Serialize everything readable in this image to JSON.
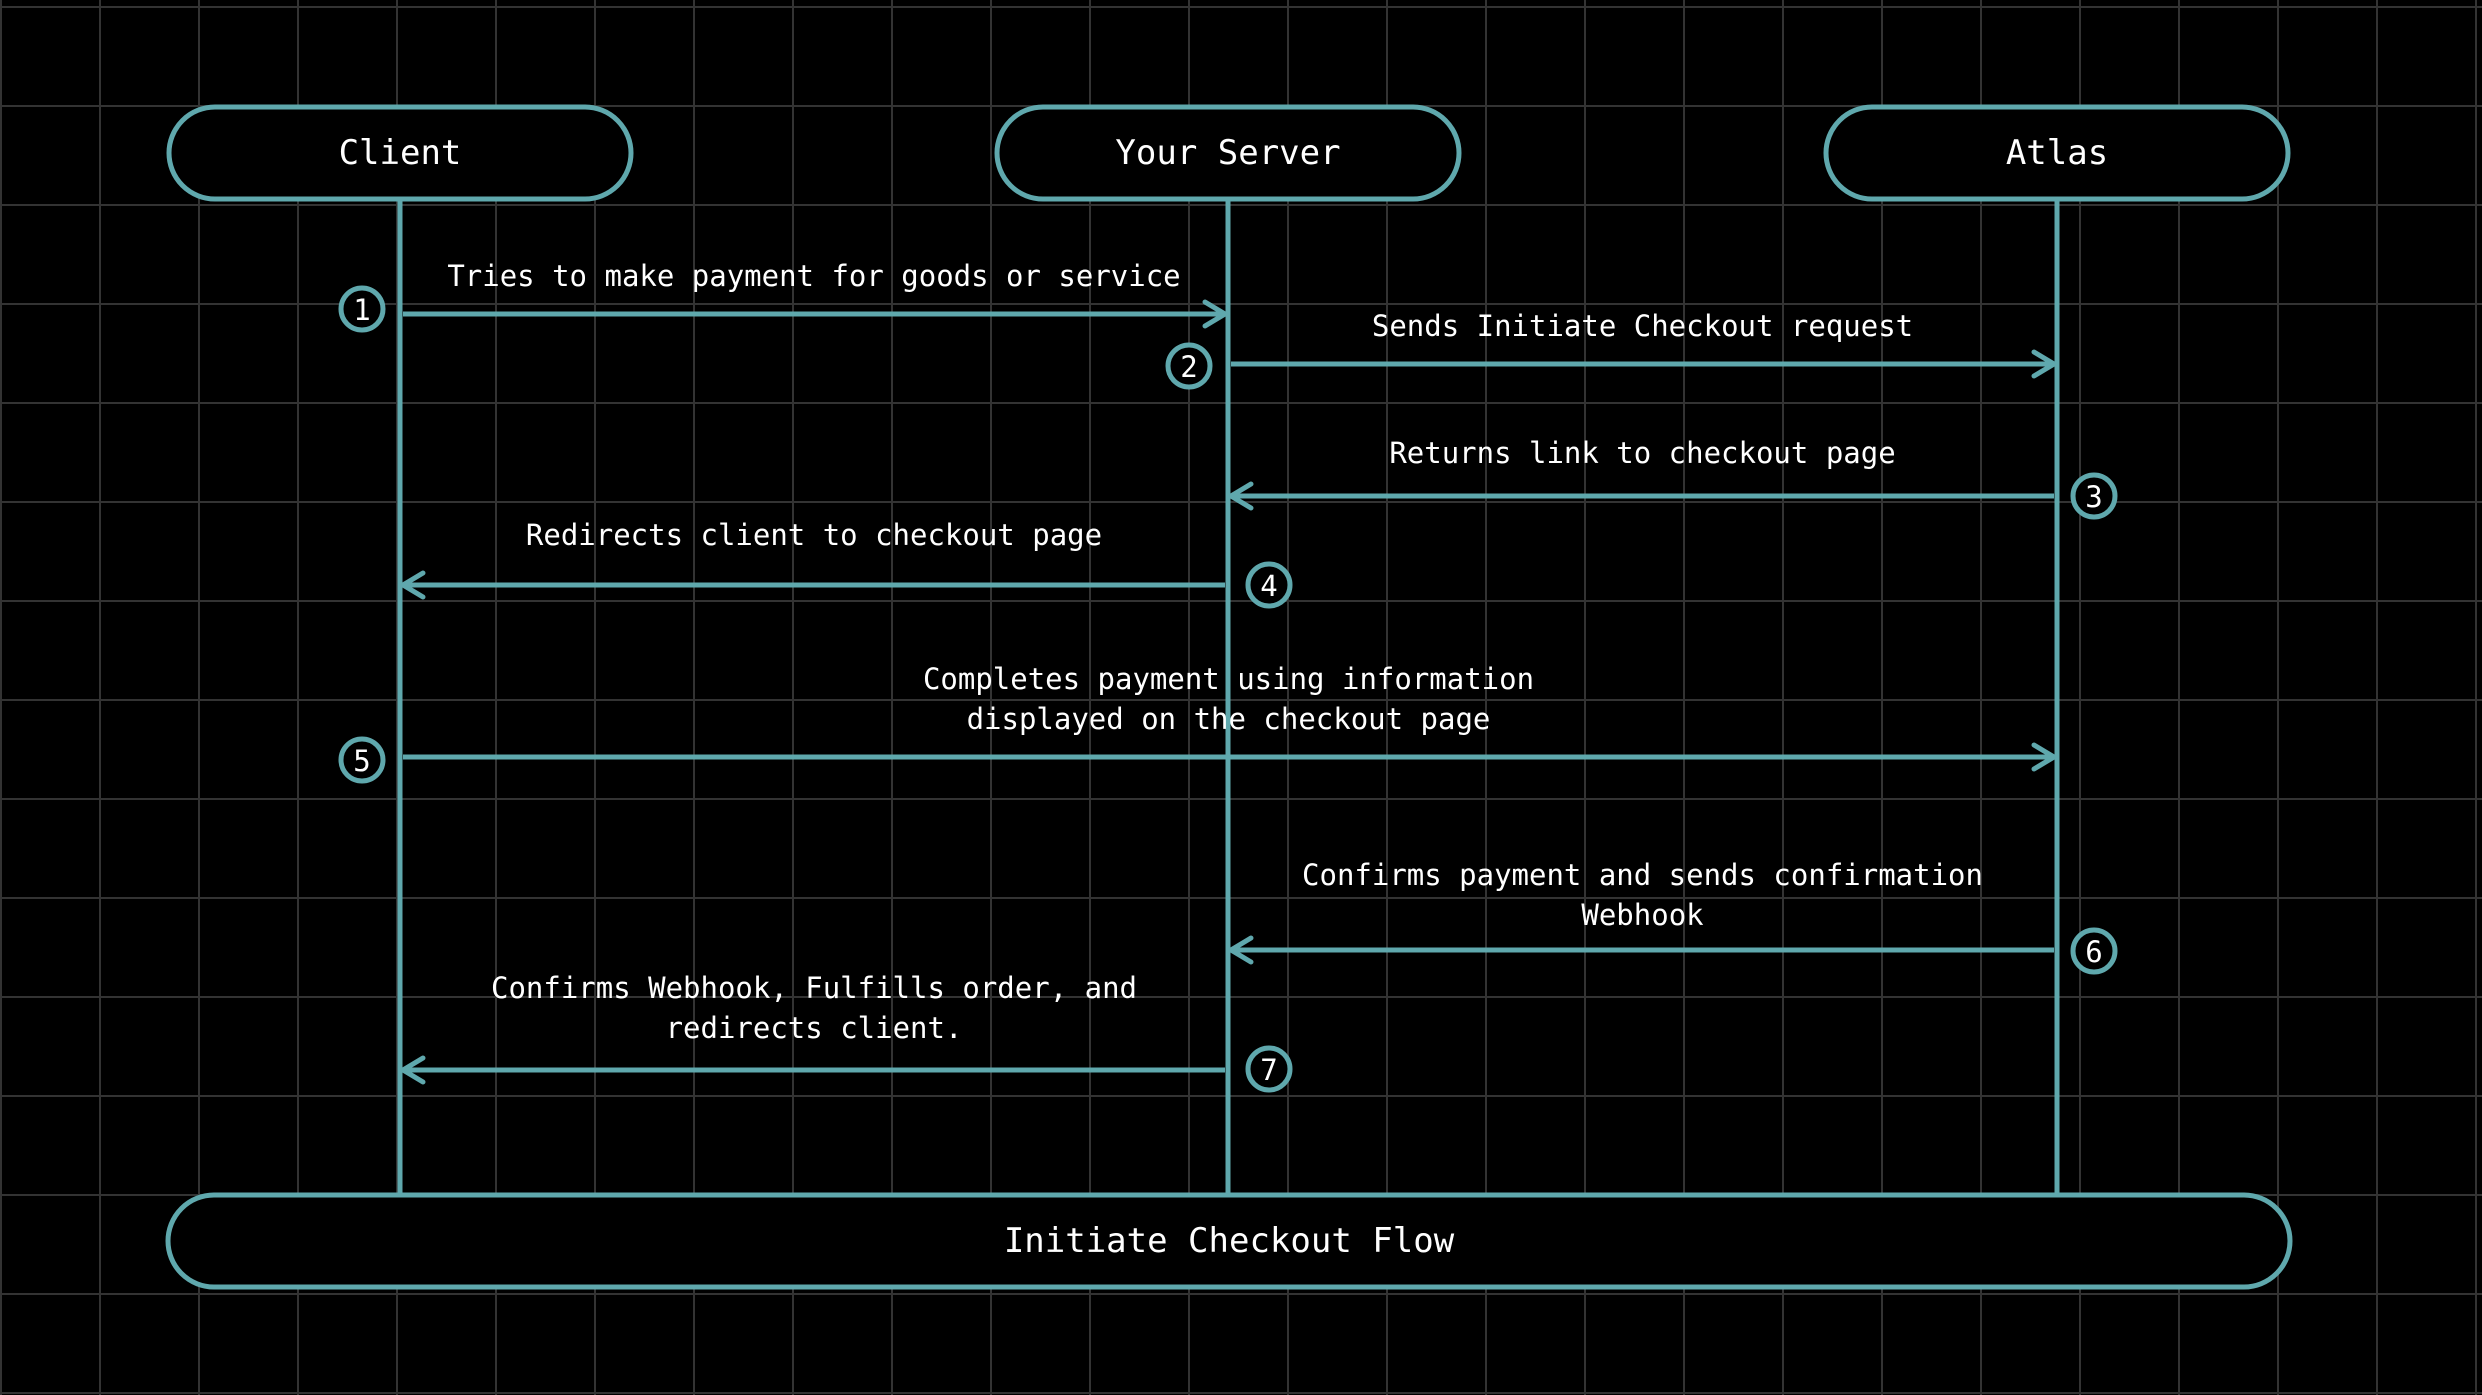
{
  "colors": {
    "background": "#000000",
    "grid": "#333333",
    "accent": "#5fa8ad",
    "text": "#ffffff"
  },
  "actors": [
    {
      "id": "client",
      "label": "Client"
    },
    {
      "id": "server",
      "label": "Your Server"
    },
    {
      "id": "atlas",
      "label": "Atlas"
    }
  ],
  "footer": {
    "label": "Initiate Checkout Flow"
  },
  "steps": [
    {
      "number": "1",
      "from": "client",
      "to": "server",
      "lines": [
        "Tries to make payment for goods or service"
      ]
    },
    {
      "number": "2",
      "from": "server",
      "to": "atlas",
      "lines": [
        "Sends Initiate Checkout request"
      ]
    },
    {
      "number": "3",
      "from": "atlas",
      "to": "server",
      "lines": [
        "Returns link to checkout page"
      ]
    },
    {
      "number": "4",
      "from": "server",
      "to": "client",
      "lines": [
        "Redirects client to checkout page"
      ]
    },
    {
      "number": "5",
      "from": "client",
      "to": "atlas",
      "lines": [
        "Completes payment using information",
        "displayed on the checkout page"
      ]
    },
    {
      "number": "6",
      "from": "atlas",
      "to": "server",
      "lines": [
        "Confirms payment and sends confirmation",
        "Webhook"
      ]
    },
    {
      "number": "7",
      "from": "server",
      "to": "client",
      "lines": [
        "Confirms Webhook, Fulfills order, and",
        "redirects client."
      ]
    }
  ]
}
